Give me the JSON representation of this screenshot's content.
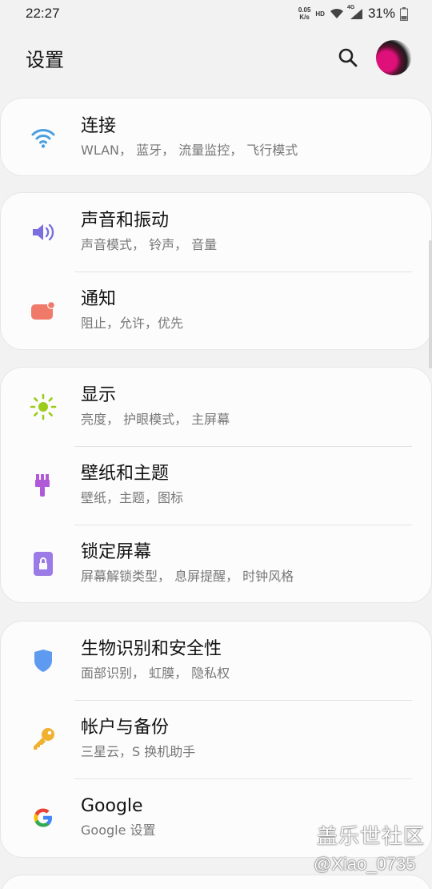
{
  "status_bar": {
    "time": "22:27",
    "net_speed_value": "0.05",
    "net_speed_unit": "K/s",
    "hd_label": "HD",
    "signal_label": "4G",
    "battery": "31%"
  },
  "header": {
    "title": "设置"
  },
  "groups": [
    {
      "items": [
        {
          "title": "连接",
          "subtitle": "WLAN， 蓝牙， 流量监控， 飞行模式",
          "icon": "wifi-icon",
          "color": "#4a9fe0"
        }
      ]
    },
    {
      "items": [
        {
          "title": "声音和振动",
          "subtitle": "声音模式， 铃声， 音量",
          "icon": "volume-icon",
          "color": "#7b6fe0"
        },
        {
          "title": "通知",
          "subtitle": "阻止，允许，优先",
          "icon": "notification-icon",
          "color": "#f07a6a"
        }
      ]
    },
    {
      "items": [
        {
          "title": "显示",
          "subtitle": "亮度， 护眼模式， 主屏幕",
          "icon": "brightness-icon",
          "color": "#9ccc1a"
        },
        {
          "title": "壁纸和主题",
          "subtitle": "壁纸，主题，图标",
          "icon": "paintbrush-icon",
          "color": "#b05ad8"
        },
        {
          "title": "锁定屏幕",
          "subtitle": "屏幕解锁类型， 息屏提醒， 时钟风格",
          "icon": "lock-icon",
          "color": "#9b7be6"
        }
      ]
    },
    {
      "items": [
        {
          "title": "生物识别和安全性",
          "subtitle": "面部识别， 虹膜， 隐私权",
          "icon": "shield-icon",
          "color": "#5e9bf0"
        },
        {
          "title": "帐户与备份",
          "subtitle": "三星云，S 换机助手",
          "icon": "key-icon",
          "color": "#f0b030"
        },
        {
          "title": "Google",
          "subtitle": "Google 设置",
          "icon": "google-icon",
          "color": "#4285f4"
        }
      ]
    }
  ],
  "watermark": {
    "line1": "盖乐世社区",
    "line2": "@Xiao_0735"
  }
}
